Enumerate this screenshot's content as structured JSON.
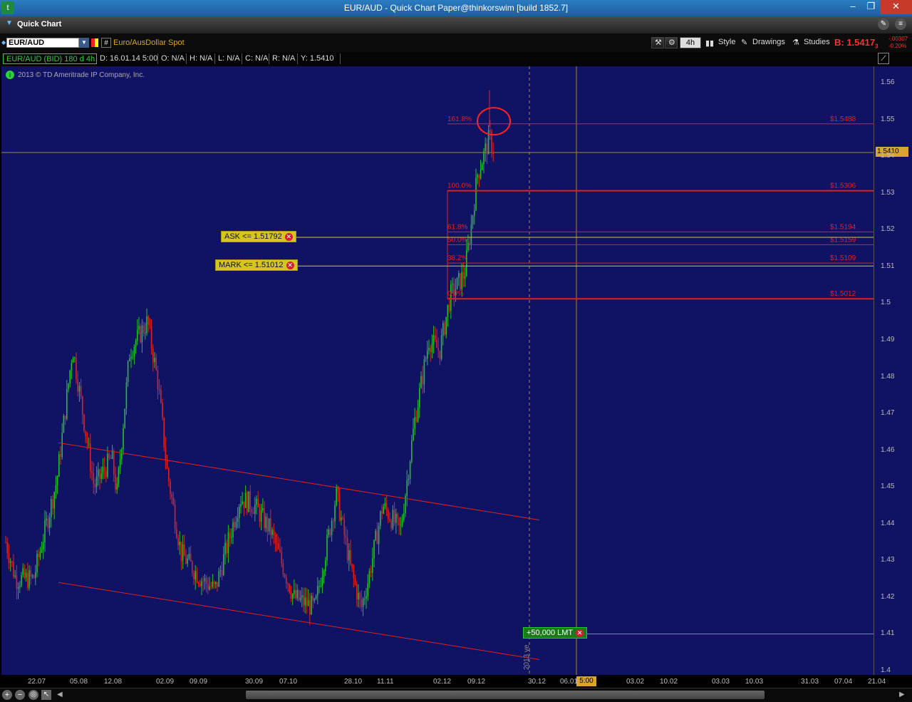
{
  "window": {
    "title": "EUR/AUD - Quick Chart Paper@thinkorswim [build 1852.7]",
    "minimize": "–",
    "maximize": "❐",
    "close": "✕"
  },
  "header": {
    "title": "Quick Chart"
  },
  "toolbar": {
    "symbol": "EUR/AUD",
    "description": "Euro/AusDollar Spot",
    "timeframe": "4h",
    "style": "Style",
    "drawings": "Drawings",
    "studies": "Studies",
    "bid_label": "B: 1.5417",
    "bid_sup": "3",
    "change": "-.00307",
    "change_pct": "-0.20%"
  },
  "infobar": {
    "instrument": "EUR/AUD (BID) 180 d 4h",
    "date": "D: 16.01.14 5:00",
    "open": "O: N/A",
    "high": "H: N/A",
    "low": "L: N/A",
    "close": "C: N/A",
    "range": "R: N/A",
    "y": "Y: 1.5410"
  },
  "chart": {
    "copyright": "2013 © TD Ameritrade IP Company, Inc.",
    "last_price": "1.5410",
    "year_label": "2013 ye",
    "cursor_time": "5:00",
    "y_ticks": [
      "1.56",
      "1.55",
      "1.54",
      "1.53",
      "1.52",
      "1.51",
      "1.5",
      "1.49",
      "1.48",
      "1.47",
      "1.46",
      "1.45",
      "1.44",
      "1.43",
      "1.42",
      "1.41",
      "1.4"
    ],
    "x_ticks": [
      "22.07",
      "05.08",
      "12.08",
      "02.09",
      "09.09",
      "30.09",
      "07.10",
      "28.10",
      "11.11",
      "02.12",
      "09.12",
      "30.12",
      "06.01",
      "03.02",
      "10.02",
      "03.03",
      "10.03",
      "31.03",
      "07.04",
      "21.04"
    ],
    "fib_levels": [
      {
        "pct": "161.8%",
        "price": "$1.5488"
      },
      {
        "pct": "100.0%",
        "price": "$1.5306"
      },
      {
        "pct": "61.8%",
        "price": "$1.5194"
      },
      {
        "pct": "50.0%",
        "price": "$1.5159"
      },
      {
        "pct": "38.2%",
        "price": "$1.5109"
      },
      {
        "pct": "0.0%",
        "price": "$1.5012"
      }
    ],
    "orders": {
      "ask": "ASK <= 1.51792",
      "mark": "MARK <= 1.51012",
      "limit": "+50,000 LMT"
    },
    "colors": {
      "background": "#101364",
      "up": "#22c02a",
      "down": "#e02020",
      "fib": "#e02020",
      "order": "#d4c520"
    }
  },
  "chart_data": {
    "type": "candlestick",
    "title": "EUR/AUD (BID) 180 d 4h",
    "ylim": [
      1.4,
      1.56
    ],
    "x": [
      "22.07",
      "05.08",
      "12.08",
      "02.09",
      "09.09",
      "30.09",
      "07.10",
      "28.10",
      "11.11",
      "02.12",
      "09.12"
    ],
    "series": [
      {
        "name": "EUR/AUD",
        "values": [
          1.435,
          1.485,
          1.448,
          1.495,
          1.428,
          1.45,
          1.428,
          1.415,
          1.44,
          1.485,
          1.542
        ]
      }
    ]
  }
}
